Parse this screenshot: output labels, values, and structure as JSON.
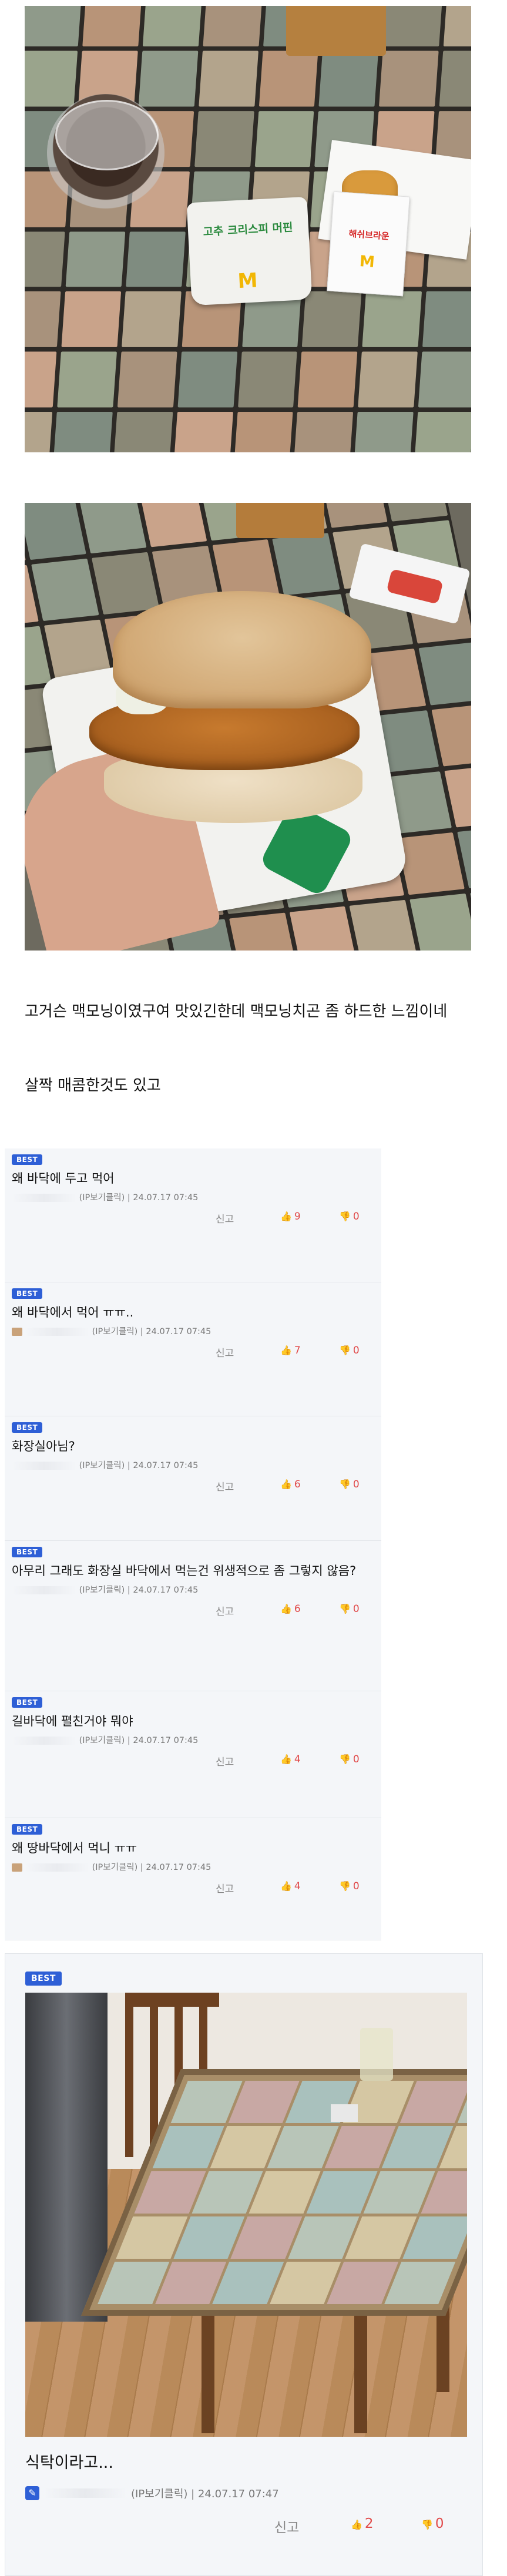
{
  "post": {
    "paragraph1": "고거슨 맥모닝이였구여 맛있긴한데 맥모닝치곤 좀 하드한 느낌이네",
    "paragraph2": "살짝 매콤한것도 있고",
    "photo1": {
      "box_label": "고추 크리스피 머핀",
      "sleeve_label": "해쉬브라운",
      "logo": "M"
    },
    "photo2": {
      "alt": "burger-in-hand"
    }
  },
  "comments": [
    {
      "badge": "BEST",
      "text": "왜 바닥에 두고 먹어",
      "meta": "(IP보기클릭) | 24.07.17 07:45",
      "report": "신고",
      "up": "9",
      "down": "0"
    },
    {
      "badge": "BEST",
      "text": "왜 바닥에서 먹어 ㅠㅠ..",
      "meta": "(IP보기클릭) | 24.07.17 07:45",
      "report": "신고",
      "up": "7",
      "down": "0"
    },
    {
      "badge": "BEST",
      "text": "화장실아님?",
      "meta": "(IP보기클릭) | 24.07.17 07:45",
      "report": "신고",
      "up": "6",
      "down": "0"
    },
    {
      "badge": "BEST",
      "text": "아무리 그래도 화장실 바닥에서 먹는건 위생적으로 좀 그렇지 않음?",
      "meta": "(IP보기클릭) | 24.07.17 07:45",
      "report": "신고",
      "up": "6",
      "down": "0"
    },
    {
      "badge": "BEST",
      "text": "길바닥에 펼친거야 뭐야",
      "meta": "(IP보기클릭) | 24.07.17 07:45",
      "report": "신고",
      "up": "4",
      "down": "0"
    },
    {
      "badge": "BEST",
      "text": "왜 땅바닥에서 먹니 ㅠㅠ",
      "meta": "(IP보기클릭) | 24.07.17 07:45",
      "report": "신고",
      "up": "4",
      "down": "0"
    }
  ],
  "big_comment": {
    "badge": "BEST",
    "text": "식탁이라고...",
    "meta": "(IP보기클릭) | 24.07.17 07:47",
    "report": "신고",
    "up": "2",
    "down": "0"
  },
  "icons": {
    "thumb_up": "thumbs-up-icon",
    "thumb_down": "thumbs-down-icon",
    "pen": "pen-icon"
  },
  "colors": {
    "badge": "#2e5fd6",
    "vote": "#e14b4b",
    "panel": "#f4f6f9"
  }
}
